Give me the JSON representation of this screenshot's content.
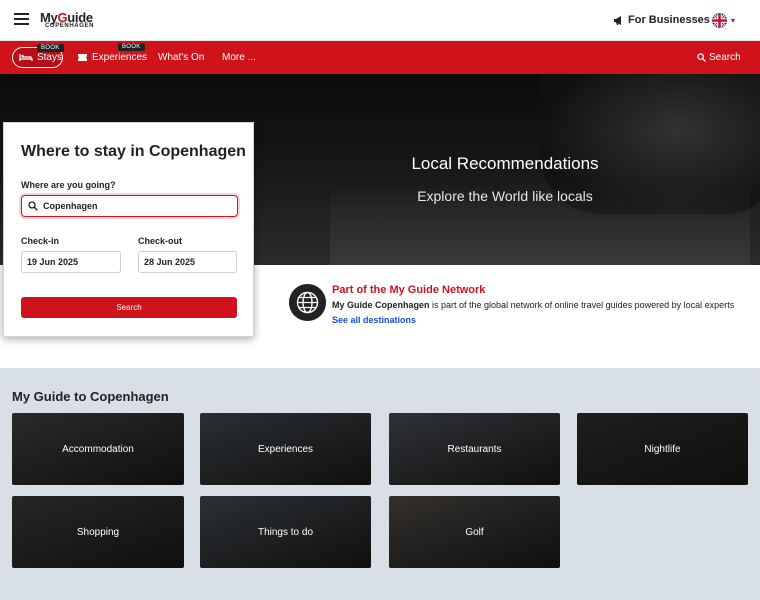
{
  "header": {
    "logo_main_left": "My",
    "logo_main_g": "G",
    "logo_main_right": "uide",
    "logo_sub": "COPENHAGEN",
    "for_businesses": "For Businesses"
  },
  "nav": {
    "stays": "Stays",
    "experiences": "Experiences",
    "whats_on": "What's On",
    "more": "More ...",
    "search": "Search",
    "book_badge": "BOOK"
  },
  "hero": {
    "title": "Local Recommendations",
    "subtitle": "Explore the World like locals"
  },
  "booking": {
    "title": "Where to stay in Copenhagen",
    "destination_label": "Where are you going?",
    "destination_value": "Copenhagen",
    "checkin_label": "Check-in",
    "checkin_value": "19 Jun 2025",
    "checkout_label": "Check-out",
    "checkout_value": "28 Jun 2025",
    "search_label": "Search"
  },
  "network": {
    "title": "Part of the My Guide Network",
    "desc_bold": "My Guide Copenhagen",
    "desc_rest": " is part of the global network of online travel guides powered by local experts",
    "link": "See all destinations"
  },
  "guide": {
    "title": "My Guide to Copenhagen",
    "tiles": [
      {
        "label": "Accommodation",
        "color": "#2a2a2a"
      },
      {
        "label": "Experiences",
        "color": "#2b2f33"
      },
      {
        "label": "Restaurants",
        "color": "#2f3236"
      },
      {
        "label": "Nightlife",
        "color": "#1e1e1e"
      },
      {
        "label": "Shopping",
        "color": "#262626"
      },
      {
        "label": "Things to do",
        "color": "#2c3034"
      },
      {
        "label": "Golf",
        "color": "#33302d"
      }
    ]
  },
  "colors": {
    "brand_red": "#d0121b",
    "link_blue": "#1a4fd6"
  }
}
